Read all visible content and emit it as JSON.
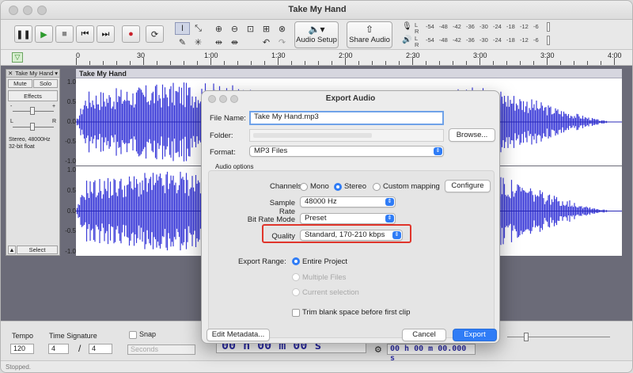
{
  "window": {
    "title": "Take My Hand"
  },
  "toolbar": {
    "audio_setup": "Audio Setup",
    "share_audio": "Share Audio",
    "meter_ticks": [
      "-54",
      "-48",
      "-42",
      "-36",
      "-30",
      "-24",
      "-18",
      "-12",
      "-6"
    ],
    "meter_lr": [
      "L",
      "R"
    ]
  },
  "timeline": {
    "ticks": [
      "0",
      "30",
      "1:00",
      "1:30",
      "2:00",
      "2:30",
      "3:00",
      "3:30",
      "4:00"
    ]
  },
  "track": {
    "name": "Take My Hand",
    "mute": "Mute",
    "solo": "Solo",
    "effects": "Effects",
    "gain_minus": "-",
    "gain_plus": "+",
    "pan_l": "L",
    "pan_r": "R",
    "info_line1": "Stereo, 48000Hz",
    "info_line2": "32-bit float",
    "select": "Select",
    "scale_top": [
      "1.0",
      "0.5",
      "0.0",
      "-0.5",
      "-1.0"
    ],
    "scale_bottom": [
      "1.0",
      "0.5",
      "0.0",
      "-0.5",
      "-1.0"
    ]
  },
  "bottom": {
    "tempo_label": "Tempo",
    "tempo_value": "120",
    "time_sig_label": "Time Signature",
    "ts_num": "4",
    "ts_slash": "/",
    "ts_den": "4",
    "snap_label": "Snap",
    "snap_value": "Seconds",
    "time_display": "00 h 00 m 00 s",
    "time_display_small": "00 h 00 m 00.000 s",
    "status": "Stopped."
  },
  "dialog": {
    "title": "Export Audio",
    "file_name_label": "File Name:",
    "file_name_value": "Take My Hand.mp3",
    "folder_label": "Folder:",
    "browse": "Browse...",
    "format_label": "Format:",
    "format_value": "MP3 Files",
    "audio_options": "Audio options",
    "channels_label": "Channels",
    "mono": "Mono",
    "stereo": "Stereo",
    "custom_mapping": "Custom mapping",
    "configure": "Configure",
    "sample_rate_label": "Sample Rate",
    "sample_rate_value": "48000 Hz",
    "bit_rate_mode_label": "Bit Rate Mode",
    "bit_rate_mode_value": "Preset",
    "quality_label": "Quality",
    "quality_value": "Standard, 170-210 kbps",
    "export_range_label": "Export Range:",
    "entire_project": "Entire Project",
    "multiple_files": "Multiple Files",
    "current_selection": "Current selection",
    "trim_blank": "Trim blank space before first clip",
    "edit_metadata": "Edit Metadata...",
    "cancel": "Cancel",
    "export": "Export"
  },
  "colors": {
    "accent": "#2f7cf6",
    "waveform": "#3c3cd8",
    "highlight": "#e0352b"
  }
}
